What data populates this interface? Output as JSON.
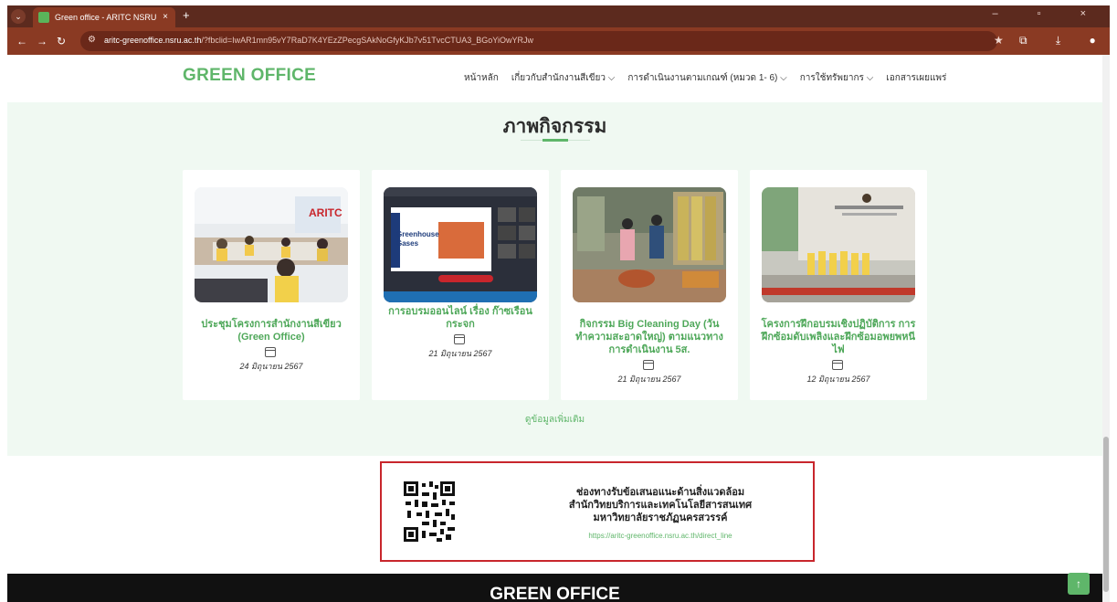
{
  "browser": {
    "tab_title": "Green office - ARITC NSRU",
    "tab_close": "×",
    "new_tab": "+",
    "url_domain": "aritc-greenoffice.nsru.ac.th",
    "url_rest": "/?fbclid=IwAR1mn95vY7RaD7K4YEzZPecgSAkNoGfyKJb7v51TvcCTUA3_BGoYiOwYRJw"
  },
  "header": {
    "logo": "GREEN OFFICE",
    "menu": [
      "หน้าหลัก",
      "เกี่ยวกับสำนักงานสีเขียว ⌵",
      "การดำเนินงานตามเกณฑ์ (หมวด 1- 6) ⌵",
      "การใช้ทรัพยากร ⌵",
      "เอกสารเผยแพร่"
    ]
  },
  "activity": {
    "title": "ภาพกิจกรรม",
    "cards": [
      {
        "title": "ประชุมโครงการสำนักงานสีเขียว (Green Office)",
        "date": "24 มิถุนายน 2567"
      },
      {
        "title": "การอบรมออนไลน์ เรื่อง ก๊าซเรือนกระจก",
        "date": "21 มิถุนายน 2567"
      },
      {
        "title": "กิจกรรม Big Cleaning Day (วันทำความสะอาดใหญ่) ตามแนวทางการดำเนินงาน 5ส.",
        "date": "21 มิถุนายน 2567"
      },
      {
        "title": "โครงการฝึกอบรมเชิงปฏิบัติการ การฝึกซ้อมดับเพลิงและฝึกซ้อมอพยพหนีไฟ",
        "date": "12 มิถุนายน 2567"
      }
    ],
    "more_link": "ดูข้อมูลเพิ่มเติม"
  },
  "contact": {
    "line1": "ช่องทางรับข้อเสนอแนะด้านสิ่งแวดล้อม",
    "line2": "สำนักวิทยบริการและเทคโนโลยีสารสนเทศ",
    "line3": "มหาวิทยาลัยราชภัฏนครสวรรค์",
    "link": "https://aritc-greenoffice.nsru.ac.th/direct_line"
  },
  "footer": {
    "title": "GREEN OFFICE"
  },
  "colors": {
    "brand_green": "#5fb66a",
    "chrome": "#8a3a23",
    "contact_border": "#c8262c"
  }
}
